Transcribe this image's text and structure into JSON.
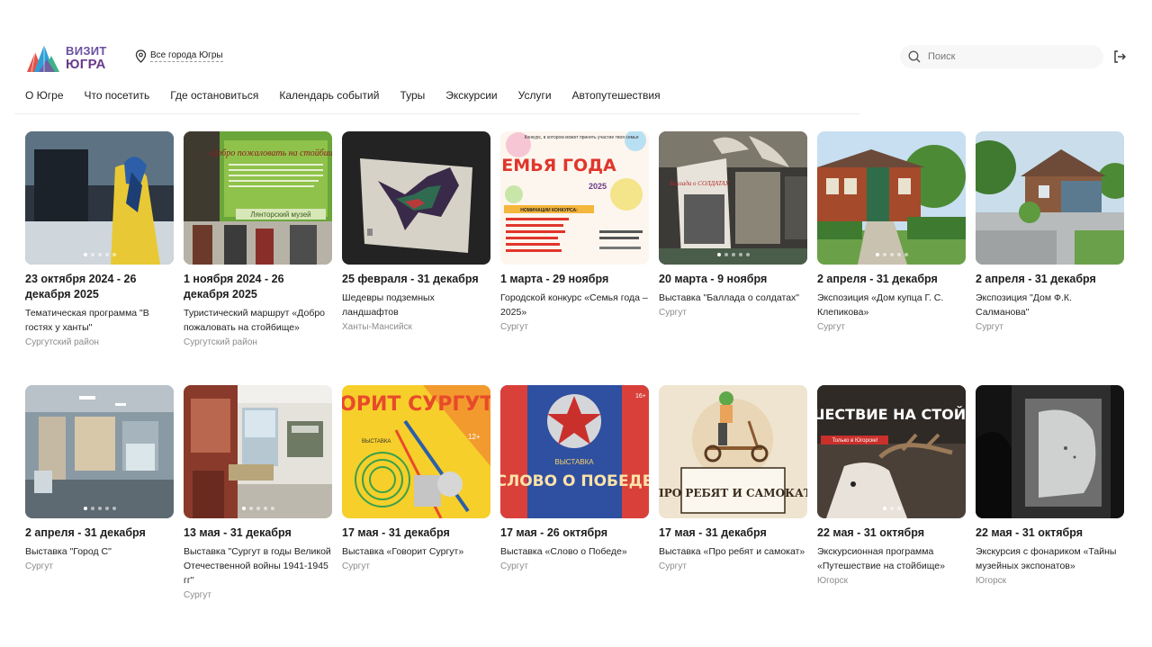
{
  "header": {
    "logo_line1": "ВИЗИТ",
    "logo_line2": "ЮГРА",
    "city": "Все города Югры",
    "search_placeholder": "Поиск"
  },
  "nav": [
    "О Югре",
    "Что посетить",
    "Где остановиться",
    "Календарь событий",
    "Туры",
    "Экскурсии",
    "Услуги",
    "Автопутешествия"
  ],
  "cards_row1": [
    {
      "date": "23 октября 2024 - 26 декабря 2025",
      "title": "Тематическая программа \"В гостях у ханты\"",
      "place": "Сургутский район",
      "icon": "dark-winter-photo"
    },
    {
      "date": "1 ноября 2024 - 26 декабря 2025",
      "title": "Туристический маршрут «Добро пожаловать на стойбище»",
      "place": "Сургутский район",
      "icon": "green-poster-photo",
      "image_text": [
        "«Добро пожаловать на стойбище»",
        "Лянторский музей"
      ]
    },
    {
      "date": "25 февраля - 31 декабря",
      "title": "Шедевры подземных ландшафтов",
      "place": "Ханты-Мансийск",
      "icon": "mineral-art-photo"
    },
    {
      "date": "1 марта - 29 ноября",
      "title": "Городской конкурс «Семья года – 2025»",
      "place": "Сургут",
      "icon": "semya-goda-poster",
      "image_text": [
        "Конкурс, в котором может принять участие твоя семья",
        "СЕМЬЯ ГОДА",
        "2025",
        "НОМИНАЦИИ КОНКУРСА:"
      ]
    },
    {
      "date": "20 марта - 9 ноября",
      "title": "Выставка \"Баллада о солдатах\"",
      "place": "Сургут",
      "icon": "exhibition-hall-photo",
      "image_text": [
        "Баллада о СОЛДАТАХ"
      ]
    },
    {
      "date": "2 апреля - 31 декабря",
      "title": "Экспозиция «Дом купца Г. С. Клепикова»",
      "place": "Сургут",
      "icon": "wooden-house-photo"
    },
    {
      "date": "2 апреля - 31 декабря",
      "title": "Экспозиция \"Дом Ф.К. Салманова\"",
      "place": "Сургут",
      "icon": "house-summer-photo"
    }
  ],
  "cards_row2": [
    {
      "date": "2 апреля - 31 декабря",
      "title": "Выставка \"Город С\"",
      "place": "Сургут",
      "icon": "museum-hall-photo"
    },
    {
      "date": "13 мая - 31 декабря",
      "title": "Выставка \"Сургут в годы Великой Отечественной войны 1941-1945 гг\"",
      "place": "Сургут",
      "icon": "exhibition-room-photo"
    },
    {
      "date": "17 мая - 31 декабря",
      "title": "Выставка «Говорит Сургут»",
      "place": "Сургут",
      "icon": "govorit-surgut-poster",
      "image_text": [
        "ГОВОРИТ СУРГУТ",
        "ВЫСТАВКА",
        "12+"
      ]
    },
    {
      "date": "17 мая - 26 октября",
      "title": "Выставка «Слово о Победе»",
      "place": "Сургут",
      "icon": "slovo-o-pobede-poster",
      "image_text": [
        "ВЫСТАВКА",
        "СЛОВО О ПОБЕДЕ",
        "16+"
      ]
    },
    {
      "date": "17 мая - 31 декабря",
      "title": "Выставка «Про ребят и самокат»",
      "place": "Сургут",
      "icon": "scooter-poster",
      "image_text": [
        "ПРО РЕБЯТ И САМОКАТ"
      ]
    },
    {
      "date": "22 мая - 31 октября",
      "title": "Экскурсионная программа «Путешествие на стойбище»",
      "place": "Югорск",
      "icon": "reindeer-poster",
      "image_text": [
        "ПУТЕШЕСТВИЕ НА СТОЙБИЩЕ",
        "Только в Югорске!"
      ]
    },
    {
      "date": "22 мая - 31 октября",
      "title": "Экскурсия с фонариком «Тайны музейных экспонатов»",
      "place": "Югорск",
      "icon": "flashlight-photo"
    }
  ]
}
